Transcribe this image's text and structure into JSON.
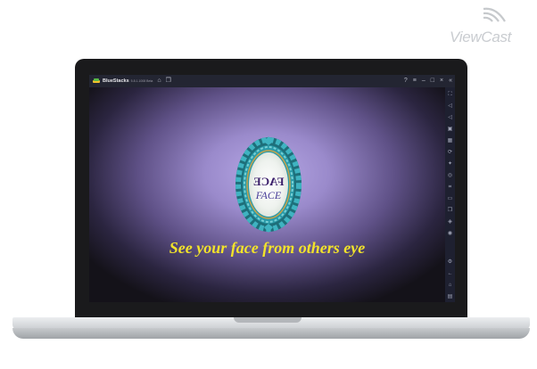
{
  "watermark": {
    "text": "ViewCast",
    "icon": "wifi-arcs-icon"
  },
  "window": {
    "app_name": "BlueStacks",
    "app_version": "5.8.1.1008 Beta",
    "toolbar_icons": [
      "home-icon",
      "multi-instance-icon"
    ],
    "controls": [
      "help-icon",
      "menu-icon",
      "minimize-icon",
      "maximize-icon",
      "close-icon",
      "collapse-icon"
    ]
  },
  "sidebar": {
    "icons": [
      "fullscreen-icon",
      "volume-up-icon",
      "volume-down-icon",
      "screen-record-icon",
      "keymap-icon",
      "rotate-icon",
      "shake-icon",
      "controls-icon",
      "screenshot-icon",
      "folder-icon",
      "copy-icon",
      "eco-icon",
      "location-icon",
      "settings-icon",
      "back-icon",
      "home-icon",
      "recents-icon"
    ]
  },
  "app": {
    "mirror_text": "FACE",
    "mirror_text_reversed": "FACE",
    "tagline": "See your face from others eye",
    "colors": {
      "tagline": "#f2e32a",
      "frame": "#2a9aa8",
      "background": "#9a8acb"
    }
  }
}
